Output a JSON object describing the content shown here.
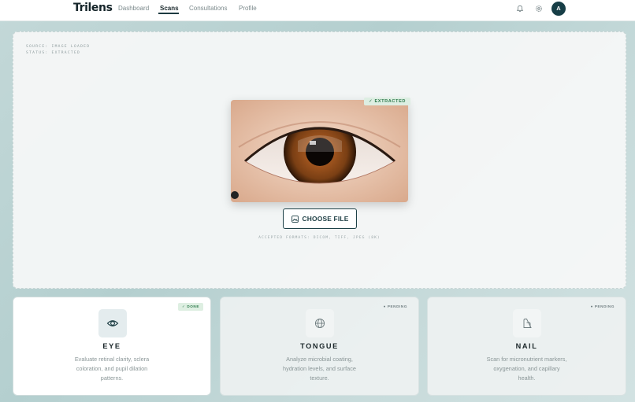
{
  "brand": "Trilens",
  "nav": [
    {
      "label": "Dashboard",
      "active": false
    },
    {
      "label": "Scans",
      "active": true
    },
    {
      "label": "Consultations",
      "active": false
    },
    {
      "label": "Profile",
      "active": false
    }
  ],
  "header_icons": [
    "bell-icon",
    "gear-icon"
  ],
  "avatar_initial": "A",
  "upload": {
    "status_lines": [
      "SOURCE: IMAGE LOADED",
      "STATUS: EXTRACTED"
    ],
    "badge": "EXTRACTED",
    "button_label": "CHOOSE FILE",
    "formats": "ACCEPTED FORMATS: DICOM, TIFF, JPEG (8K)"
  },
  "cards": [
    {
      "title": "EYE",
      "status": "DONE",
      "icon": "eye-icon",
      "desc": [
        "Evaluate retinal clarity, sclera",
        "coloration, and pupil dilation",
        "patterns."
      ]
    },
    {
      "title": "TONGUE",
      "status": "PENDING",
      "icon": "globe-icon",
      "desc": [
        "Analyze microbial coating,",
        "hydration levels, and surface",
        "texture."
      ]
    },
    {
      "title": "NAIL",
      "status": "PENDING",
      "icon": "nail-icon",
      "desc": [
        "Scan for micronutrient markers,",
        "oxygenation, and capillary",
        "health."
      ]
    }
  ],
  "colors": {
    "accent": "#173e46",
    "done": "#2e7a4c",
    "iris": "#8a4a1c"
  }
}
